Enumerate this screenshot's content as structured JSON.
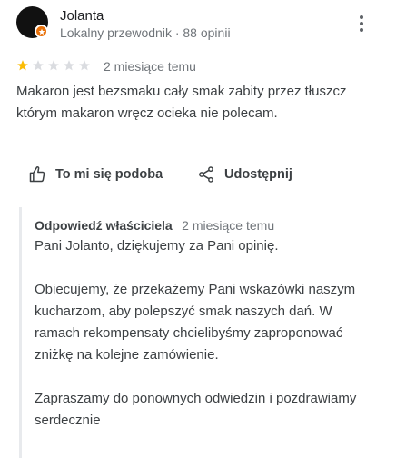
{
  "reviewer": {
    "name": "Jolanta",
    "meta": "Lokalny przewodnik · 88 opinii"
  },
  "review": {
    "rating": 1,
    "max_rating": 5,
    "date": "2 miesiące temu",
    "text": "Makaron jest bezsmaku cały smak zabity przez tłuszcz którym makaron wręcz ocieka nie polecam."
  },
  "actions": {
    "like_label": "To mi się podoba",
    "share_label": "Udostępnij"
  },
  "owner_response": {
    "label": "Odpowiedź właściciela",
    "date": "2 miesiące temu",
    "paragraphs": [
      "Pani Jolanto, dziękujemy za Pani opinię.",
      "Obiecujemy, że przekażemy Pani wskazówki naszym kucharzom, aby polepszyć smak naszych dań. W ramach rekompensaty chcielibyśmy zaproponować zniżkę na kolejne zamówienie.",
      "Zapraszamy do ponownych odwiedzin i pozdrawiamy serdecznie"
    ]
  },
  "colors": {
    "star_filled": "#fbbc04",
    "star_empty": "#dadce0",
    "local_guide_badge": "#e8710a",
    "reply_border": "#e8eaed"
  },
  "icons": {
    "more": "more-vert-icon",
    "like": "thumb-up-icon",
    "share": "share-icon",
    "badge": "local-guide-star-icon"
  }
}
